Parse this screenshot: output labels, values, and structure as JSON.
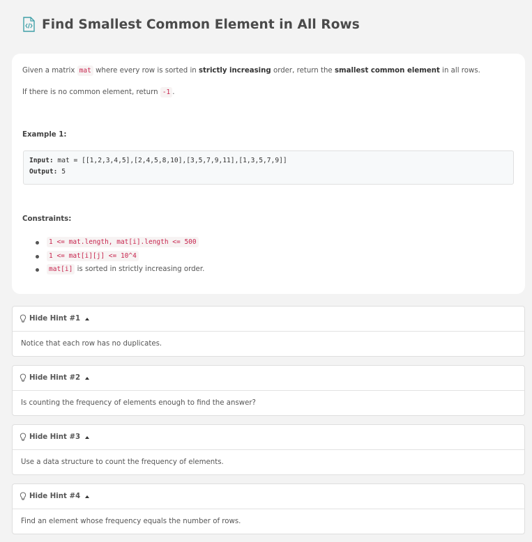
{
  "problem": {
    "title": "Find Smallest Common Element in All Rows",
    "desc_line1": {
      "p1": "Given a matrix ",
      "code": "mat",
      "p2": " where every row is sorted in ",
      "b1": "strictly increasing",
      "p3": " order, return the ",
      "b2": "smallest common element",
      "p4": " in all rows."
    },
    "desc_line2": {
      "p1": "If there is no common element, return ",
      "code": "-1",
      "p2": "."
    },
    "example_label": "Example 1:",
    "example": {
      "input_key": "Input:",
      "input_value": " mat = [[1,2,3,4,5],[2,4,5,8,10],[3,5,7,9,11],[1,3,5,7,9]]",
      "output_key": "Output:",
      "output_value": " 5"
    },
    "constraints_label": "Constraints:",
    "constraints": {
      "c1_code": "1 <= mat.length, mat[i].length <= 500",
      "c2_code": "1 <= mat[i][j] <= 10^4",
      "c3_code": "mat[i]",
      "c3_text": " is sorted in strictly increasing order."
    }
  },
  "hints": [
    {
      "label": "Hide Hint #1",
      "body": "Notice that each row has no duplicates."
    },
    {
      "label": "Hide Hint #2",
      "body": "Is counting the frequency of elements enough to find the answer?"
    },
    {
      "label": "Hide Hint #3",
      "body": "Use a data structure to count the frequency of elements."
    },
    {
      "label": "Hide Hint #4",
      "body": "Find an element whose frequency equals the number of rows."
    }
  ],
  "icons": {
    "title_icon": "document-code-icon",
    "hint_icon": "lightbulb-icon",
    "toggle_icon": "caret-up-icon"
  },
  "colors": {
    "accent": "#3fa0a8",
    "code_text": "#c7254e",
    "page_bg": "#f3f3f3"
  }
}
